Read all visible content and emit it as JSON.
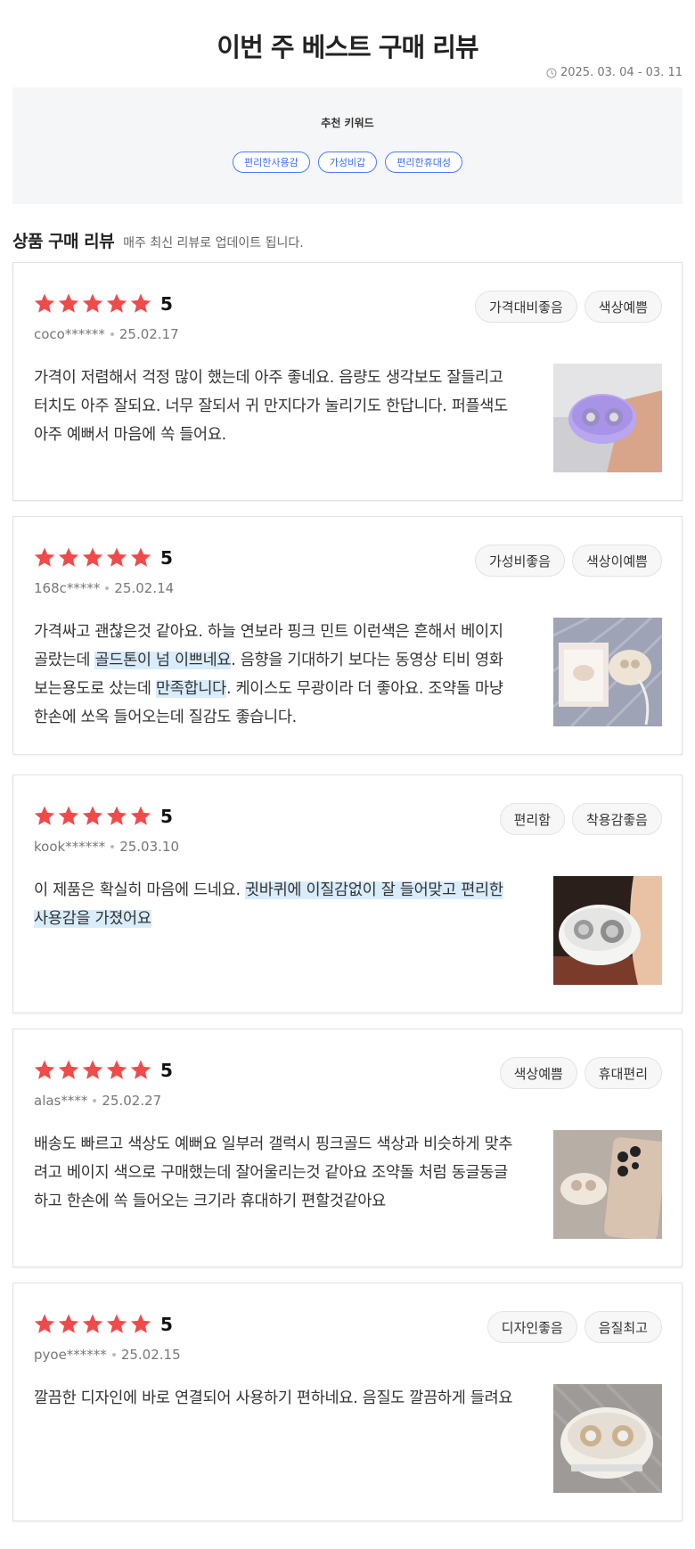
{
  "header": {
    "title": "이번 주 베스트 구매 리뷰",
    "period": "2025. 03. 04 - 03. 11"
  },
  "keywords": {
    "title": "추천 키워드",
    "items": [
      "편리한사용감",
      "가성비갑",
      "편리한휴대성"
    ]
  },
  "section": {
    "title": "상품 구매 리뷰",
    "desc": "매주 최신 리뷰로 업데이트 됩니다."
  },
  "colors": {
    "star": "#ef4b4b",
    "highlight": "#d9ecfb",
    "keyword_accent": "#4a7bf7"
  },
  "reviews": [
    {
      "rating": "5",
      "user": "coco******",
      "date": "25.02.17",
      "tags": [
        "가격대비좋음",
        "색상예쁨"
      ],
      "text": [
        {
          "t": "가격이 저렴해서 걱정 많이 했는데 아주 좋네요. 음량도 생각보도 잘들리고 터치도 아주 잘되요. 너무 잘되서 귀 만지다가 눌리기도 한답니다. 퍼플색도 아주 예뻐서 마음에 쏙 들어요.",
          "h": false
        }
      ],
      "image": "purple-earbuds-photo"
    },
    {
      "rating": "5",
      "user": "168c*****",
      "date": "25.02.14",
      "tags": [
        "가성비좋음",
        "색상이예쁨"
      ],
      "text": [
        {
          "t": "가격싸고 괜찮은것 같아요. 하늘 연보라 핑크 민트 이런색은 흔해서 베이지 골랐는데 ",
          "h": false
        },
        {
          "t": "골드톤이 넘 이쁘네요",
          "h": true
        },
        {
          "t": ". 음향을 기대하기 보다는 동영상 티비 영화 보는용도로 샀는데 ",
          "h": false
        },
        {
          "t": "만족합니다",
          "h": true
        },
        {
          "t": ". 케이스도 무광이라 더 좋아요. 조약돌 마냥 한손에 쏘옥 들어오는데 질감도 좋습니다.",
          "h": false
        }
      ],
      "image": "beige-earbuds-box-photo"
    },
    {
      "rating": "5",
      "user": "kook******",
      "date": "25.03.10",
      "tags": [
        "편리함",
        "착용감좋음"
      ],
      "text": [
        {
          "t": "이 제품은 확실히 마음에 드네요. ",
          "h": false
        },
        {
          "t": "귓바퀴에 이질감없이 잘 들어맞고 편리한 사용감을 가졌어요",
          "h": true
        }
      ],
      "image": "white-earbuds-hand-photo"
    },
    {
      "rating": "5",
      "user": "alas****",
      "date": "25.02.27",
      "tags": [
        "색상예쁨",
        "휴대편리"
      ],
      "text": [
        {
          "t": "배송도 빠르고 색상도 예뻐요 일부러 갤럭시 핑크골드 색상과 비슷하게 맞추려고 베이지 색으로 구매했는데 잘어울리는것 같아요 조약돌 처럼 동글동글하고 한손에 쏙 들어오는 크기라 휴대하기 편할것같아요",
          "h": false
        }
      ],
      "image": "earbuds-with-phone-photo"
    },
    {
      "rating": "5",
      "user": "pyoe******",
      "date": "25.02.15",
      "tags": [
        "디자인좋음",
        "음질최고"
      ],
      "text": [
        {
          "t": "깔끔한 디자인에 바로 연결되어 사용하기 편하네요. 음질도 깔끔하게 들려요",
          "h": false
        }
      ],
      "image": "white-earbuds-case-photo"
    }
  ]
}
